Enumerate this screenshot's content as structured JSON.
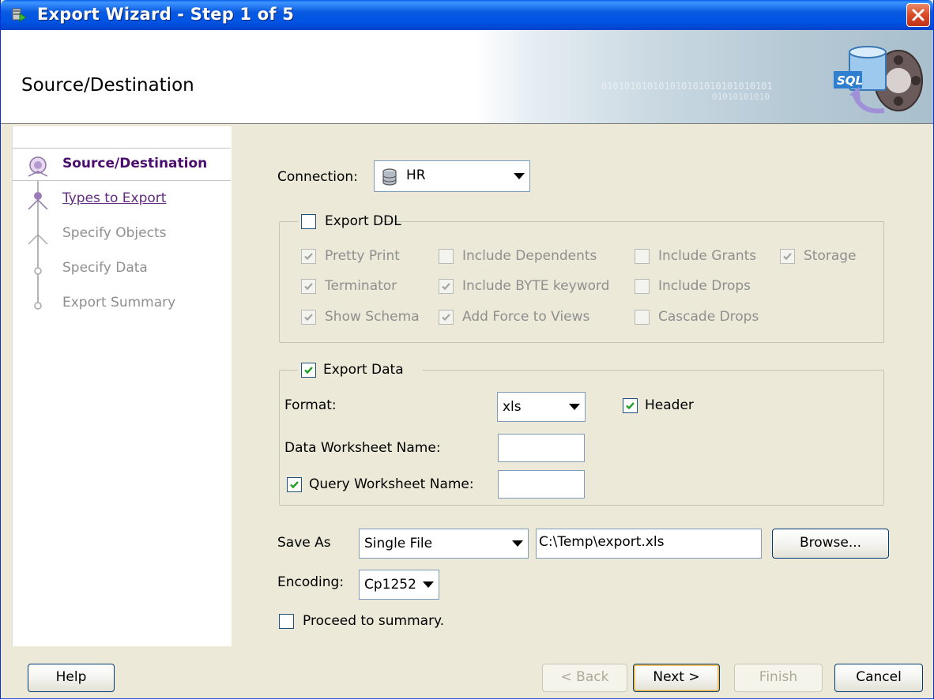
{
  "window": {
    "title": "Export Wizard - Step 1 of 5"
  },
  "header": {
    "title": "Source/Destination",
    "binary_1": "010101010101010101010101010101",
    "binary_2": "01010101010"
  },
  "nav": {
    "items": [
      {
        "label": "Source/Destination",
        "state": "active"
      },
      {
        "label": "Types to Export",
        "state": "link"
      },
      {
        "label": "Specify Objects",
        "state": "disabled"
      },
      {
        "label": "Specify Data",
        "state": "disabled"
      },
      {
        "label": "Export Summary",
        "state": "disabled"
      }
    ]
  },
  "connection": {
    "label": "Connection:",
    "value": "HR"
  },
  "export_ddl": {
    "label": "Export DDL",
    "checked": false,
    "options": {
      "pretty_print": {
        "label": "Pretty Print",
        "checked": true
      },
      "include_dependents": {
        "label": "Include Dependents",
        "checked": false
      },
      "include_grants": {
        "label": "Include Grants",
        "checked": false
      },
      "storage": {
        "label": "Storage",
        "checked": true
      },
      "terminator": {
        "label": "Terminator",
        "checked": true
      },
      "include_byte": {
        "label": "Include BYTE keyword",
        "checked": true
      },
      "include_drops": {
        "label": "Include Drops",
        "checked": false
      },
      "show_schema": {
        "label": "Show Schema",
        "checked": true
      },
      "add_force": {
        "label": "Add Force to Views",
        "checked": true
      },
      "cascade_drops": {
        "label": "Cascade Drops",
        "checked": false
      }
    }
  },
  "export_data": {
    "label": "Export Data",
    "checked": true,
    "format_label": "Format:",
    "format_value": "xls",
    "header_label": "Header",
    "header_checked": true,
    "data_ws_label": "Data Worksheet Name:",
    "data_ws_value": "",
    "query_ws_label": "Query Worksheet Name:",
    "query_ws_checked": true,
    "query_ws_value": ""
  },
  "save_as": {
    "label": "Save As",
    "mode": "Single File",
    "path": "C:\\Temp\\export.xls",
    "browse_label": "Browse..."
  },
  "encoding": {
    "label": "Encoding:",
    "value": "Cp1252"
  },
  "proceed": {
    "label": "Proceed to summary.",
    "checked": false
  },
  "buttons": {
    "help": "Help",
    "back": "< Back",
    "next": "Next >",
    "finish": "Finish",
    "cancel": "Cancel"
  }
}
